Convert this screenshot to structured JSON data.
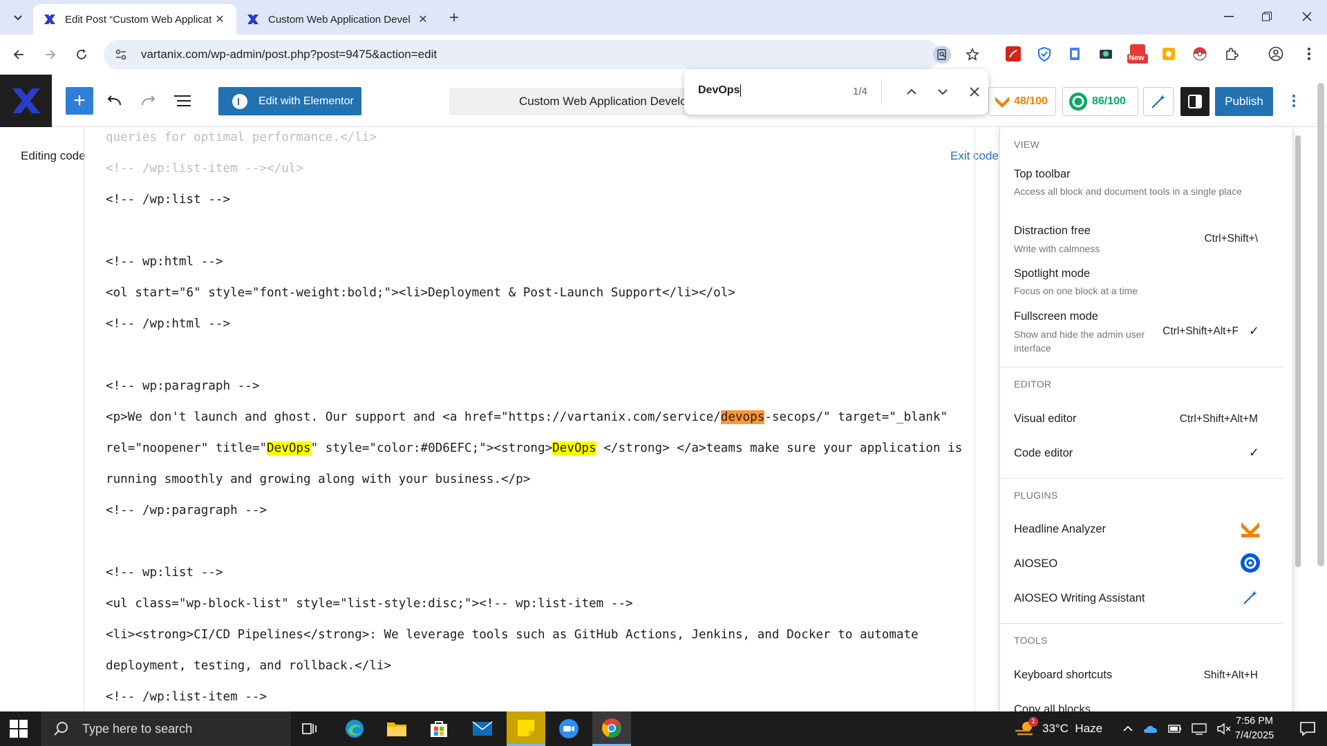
{
  "browser": {
    "tabs": [
      {
        "title": "Edit Post “Custom Web Applicat",
        "active": true
      },
      {
        "title": "Custom Web Application Devel",
        "active": false
      }
    ],
    "url": "vartanix.com/wp-admin/post.php?post=9475&action=edit",
    "ext_new_badge": "New"
  },
  "find": {
    "query": "DevOps",
    "count": "1/4"
  },
  "wp": {
    "elementor_label": "Edit with Elementor",
    "doc_title": "Custom Web Application Develop",
    "headline_score": "48/100",
    "seo_score": "86/100",
    "publish_label": "Publish",
    "editing_code": "Editing code",
    "exit_code": "Exit code"
  },
  "code": {
    "l1": "queries for optimal performance.</li>",
    "l2": "<!-- /wp:list-item --></ul>",
    "l3": "<!-- /wp:list -->",
    "l4": "<!-- wp:html -->",
    "l5": "<ol start=\"6\" style=\"font-weight:bold;\"><li>Deployment & Post-Launch Support</li></ol>",
    "l6": "<!-- /wp:html -->",
    "l7": "<!-- wp:paragraph -->",
    "l8a": "<p>We don't launch and ghost. Our support and <a href=\"https://vartanix.com/service/",
    "l8h": "devops",
    "l8b": "-secops/\" target=\"_blank\"",
    "l9a": "rel=\"noopener\" title=\"",
    "l9h1": "DevOps",
    "l9b": "\" style=\"color:#0D6EFC;\"><strong>",
    "l9h2": "DevOps",
    "l9c": " </strong> </a>teams make sure your application is",
    "l10": "running smoothly and growing along with your business.</p>",
    "l11": "<!-- /wp:paragraph -->",
    "l12": "<!-- wp:list -->",
    "l13": "<ul class=\"wp-block-list\" style=\"list-style:disc;\"><!-- wp:list-item -->",
    "l14": "<li><strong>CI/CD Pipelines</strong>: We leverage tools such as GitHub Actions, Jenkins, and Docker to automate",
    "l15": "deployment, testing, and rollback.</li>",
    "l16": "<!-- /wp:list-item -->"
  },
  "menu": {
    "view_heading": "VIEW",
    "top_toolbar": "Top toolbar",
    "top_toolbar_desc": "Access all block and document tools in a single place",
    "distraction_free": "Distraction free",
    "distraction_free_desc": "Write with calmness",
    "distraction_free_shortcut": "Ctrl+Shift+\\",
    "spotlight": "Spotlight mode",
    "spotlight_desc": "Focus on one block at a time",
    "fullscreen": "Fullscreen mode",
    "fullscreen_desc": "Show and hide the admin user interface",
    "fullscreen_shortcut": "Ctrl+Shift+Alt+F",
    "editor_heading": "EDITOR",
    "visual_editor": "Visual editor",
    "visual_editor_shortcut": "Ctrl+Shift+Alt+M",
    "code_editor": "Code editor",
    "plugins_heading": "PLUGINS",
    "headline_analyzer": "Headline Analyzer",
    "aioseo": "AIOSEO",
    "aioseo_writing": "AIOSEO Writing Assistant",
    "tools_heading": "TOOLS",
    "keyboard_shortcuts": "Keyboard shortcuts",
    "keyboard_shortcuts_shortcut": "Shift+Alt+H",
    "copy_all_blocks": "Copy all blocks",
    "checkmark": "✓"
  },
  "taskbar": {
    "search_placeholder": "Type here to search",
    "weather": "33°C  Haze",
    "weather_badge": "1",
    "time": "7:56 PM",
    "date": "7/4/2025"
  },
  "colors": {
    "wp_blue": "#2271b1",
    "highlight": "#ffff00",
    "highlight_current": "#ff9632"
  }
}
